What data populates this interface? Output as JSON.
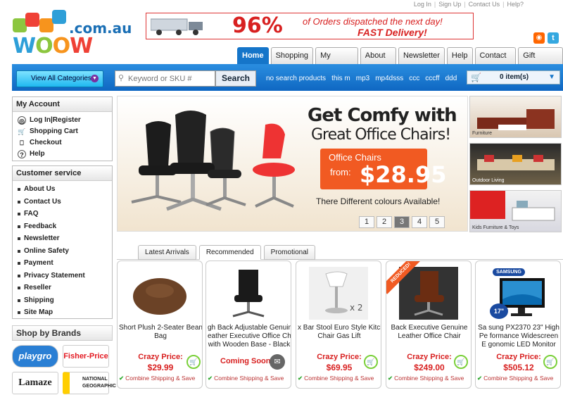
{
  "top_links": [
    "Log In",
    "Sign Up",
    "Contact Us",
    "Help?"
  ],
  "logo": {
    "word": "WOOW",
    "domain": ".com.au"
  },
  "banner": {
    "percent": "96%",
    "line1": "of Orders dispatched the next day!",
    "line2": "FAST Delivery!"
  },
  "nav_tabs": [
    "Home",
    "Shopping",
    "My Account",
    "About Us",
    "Newsletter",
    "Help",
    "Contact Us",
    "Gift Voucher"
  ],
  "search": {
    "categories_label": "View All Categories",
    "placeholder": "Keyword or SKU #",
    "button": "Search"
  },
  "quick_links": [
    "no search products",
    "this m",
    "mp3",
    "mp4dsss",
    "ccc",
    "cccff",
    "ddd"
  ],
  "cart": {
    "count_text": "0 item(s)"
  },
  "my_account": {
    "title": "My Account",
    "items": [
      "Log In|Register",
      "Shopping Cart",
      "Checkout",
      "Help"
    ]
  },
  "customer_service": {
    "title": "Customer service",
    "items": [
      "About Us",
      "Contact Us",
      "FAQ",
      "Feedback",
      "Newsletter",
      "Online Safety",
      "Payment",
      "Privacy Statement",
      "Reseller",
      "Shipping",
      "Site Map"
    ]
  },
  "brands": {
    "title": "Shop by Brands",
    "items": [
      "playgro",
      "Fisher-Price",
      "Lamaze",
      "NATIONAL GEOGRAPHIC"
    ]
  },
  "hero": {
    "headline1": "Get Comfy with",
    "headline2": "Great Office Chairs!",
    "offer_title": "Office Chairs",
    "offer_from": "from:",
    "offer_price": "$28.95",
    "subtitle": "There Different colours Available!",
    "pages": [
      "1",
      "2",
      "3",
      "4",
      "5"
    ],
    "active_page": "3"
  },
  "side_categories": [
    "Furniture",
    "Outdoor Living",
    "Kids Furniture & Toys"
  ],
  "product_tabs": [
    "Latest Arrivals",
    "Recommended",
    "Promotional"
  ],
  "active_tab": "Recommended",
  "products": [
    {
      "name1": "Short Plush 2-Seater Bean",
      "name2": "Bag",
      "label": "Crazy Price:",
      "price": "$29.99",
      "ship": "Combine Shipping & Save"
    },
    {
      "name1": "gh Back Adjustable Genuine",
      "name2": "eather Executive Office Chair",
      "name3": "with Wooden Base - Black",
      "label": "Coming Soon",
      "price": "",
      "ship": "Combine Shipping & Save"
    },
    {
      "name1": "x Bar Stool Euro Style Kitche",
      "name2": "Chair Gas Lift",
      "label": "Crazy Price:",
      "price": "$69.95",
      "ship": "Combine Shipping & Save"
    },
    {
      "name1": "Back Executive Genuine",
      "name2": "Leather Office Chair",
      "label": "Crazy Price:",
      "price": "$249.00",
      "ship": "Combine Shipping & Save",
      "badge": "REDUCED!"
    },
    {
      "name1": "Sa sung PX2370 23\" High",
      "name2": "Pe formance Widescreen",
      "name3": "E gonomic LED Monitor",
      "label": "Crazy Price:",
      "price": "$505.12",
      "ship": "Combine Shipping & Save",
      "badge": "SAMSUNG",
      "size": "17\""
    }
  ],
  "colors": {
    "brand_blue": "#1575c9",
    "price_red": "#d82020",
    "offer_orange": "#f15a22",
    "cart_green": "#7ad03a"
  }
}
